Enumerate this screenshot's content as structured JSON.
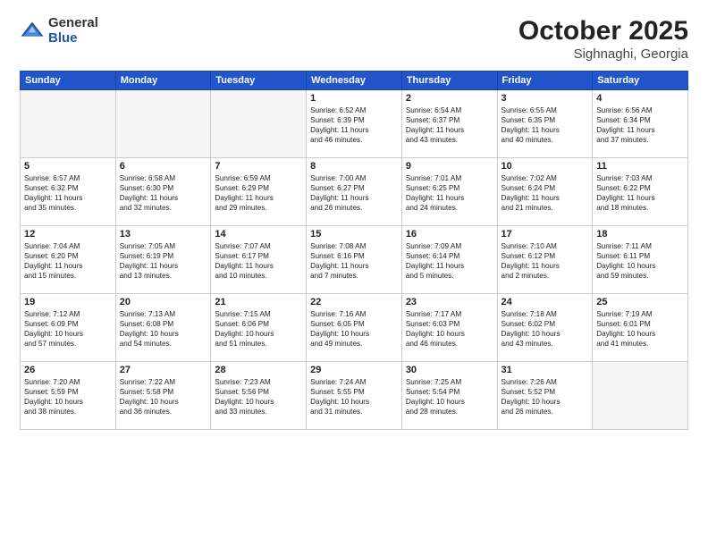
{
  "header": {
    "logo_general": "General",
    "logo_blue": "Blue",
    "month_title": "October 2025",
    "location": "Sighnaghi, Georgia"
  },
  "weekdays": [
    "Sunday",
    "Monday",
    "Tuesday",
    "Wednesday",
    "Thursday",
    "Friday",
    "Saturday"
  ],
  "weeks": [
    [
      {
        "day": "",
        "info": ""
      },
      {
        "day": "",
        "info": ""
      },
      {
        "day": "",
        "info": ""
      },
      {
        "day": "1",
        "info": "Sunrise: 6:52 AM\nSunset: 6:39 PM\nDaylight: 11 hours\nand 46 minutes."
      },
      {
        "day": "2",
        "info": "Sunrise: 6:54 AM\nSunset: 6:37 PM\nDaylight: 11 hours\nand 43 minutes."
      },
      {
        "day": "3",
        "info": "Sunrise: 6:55 AM\nSunset: 6:35 PM\nDaylight: 11 hours\nand 40 minutes."
      },
      {
        "day": "4",
        "info": "Sunrise: 6:56 AM\nSunset: 6:34 PM\nDaylight: 11 hours\nand 37 minutes."
      }
    ],
    [
      {
        "day": "5",
        "info": "Sunrise: 6:57 AM\nSunset: 6:32 PM\nDaylight: 11 hours\nand 35 minutes."
      },
      {
        "day": "6",
        "info": "Sunrise: 6:58 AM\nSunset: 6:30 PM\nDaylight: 11 hours\nand 32 minutes."
      },
      {
        "day": "7",
        "info": "Sunrise: 6:59 AM\nSunset: 6:29 PM\nDaylight: 11 hours\nand 29 minutes."
      },
      {
        "day": "8",
        "info": "Sunrise: 7:00 AM\nSunset: 6:27 PM\nDaylight: 11 hours\nand 26 minutes."
      },
      {
        "day": "9",
        "info": "Sunrise: 7:01 AM\nSunset: 6:25 PM\nDaylight: 11 hours\nand 24 minutes."
      },
      {
        "day": "10",
        "info": "Sunrise: 7:02 AM\nSunset: 6:24 PM\nDaylight: 11 hours\nand 21 minutes."
      },
      {
        "day": "11",
        "info": "Sunrise: 7:03 AM\nSunset: 6:22 PM\nDaylight: 11 hours\nand 18 minutes."
      }
    ],
    [
      {
        "day": "12",
        "info": "Sunrise: 7:04 AM\nSunset: 6:20 PM\nDaylight: 11 hours\nand 15 minutes."
      },
      {
        "day": "13",
        "info": "Sunrise: 7:05 AM\nSunset: 6:19 PM\nDaylight: 11 hours\nand 13 minutes."
      },
      {
        "day": "14",
        "info": "Sunrise: 7:07 AM\nSunset: 6:17 PM\nDaylight: 11 hours\nand 10 minutes."
      },
      {
        "day": "15",
        "info": "Sunrise: 7:08 AM\nSunset: 6:16 PM\nDaylight: 11 hours\nand 7 minutes."
      },
      {
        "day": "16",
        "info": "Sunrise: 7:09 AM\nSunset: 6:14 PM\nDaylight: 11 hours\nand 5 minutes."
      },
      {
        "day": "17",
        "info": "Sunrise: 7:10 AM\nSunset: 6:12 PM\nDaylight: 11 hours\nand 2 minutes."
      },
      {
        "day": "18",
        "info": "Sunrise: 7:11 AM\nSunset: 6:11 PM\nDaylight: 10 hours\nand 59 minutes."
      }
    ],
    [
      {
        "day": "19",
        "info": "Sunrise: 7:12 AM\nSunset: 6:09 PM\nDaylight: 10 hours\nand 57 minutes."
      },
      {
        "day": "20",
        "info": "Sunrise: 7:13 AM\nSunset: 6:08 PM\nDaylight: 10 hours\nand 54 minutes."
      },
      {
        "day": "21",
        "info": "Sunrise: 7:15 AM\nSunset: 6:06 PM\nDaylight: 10 hours\nand 51 minutes."
      },
      {
        "day": "22",
        "info": "Sunrise: 7:16 AM\nSunset: 6:05 PM\nDaylight: 10 hours\nand 49 minutes."
      },
      {
        "day": "23",
        "info": "Sunrise: 7:17 AM\nSunset: 6:03 PM\nDaylight: 10 hours\nand 46 minutes."
      },
      {
        "day": "24",
        "info": "Sunrise: 7:18 AM\nSunset: 6:02 PM\nDaylight: 10 hours\nand 43 minutes."
      },
      {
        "day": "25",
        "info": "Sunrise: 7:19 AM\nSunset: 6:01 PM\nDaylight: 10 hours\nand 41 minutes."
      }
    ],
    [
      {
        "day": "26",
        "info": "Sunrise: 7:20 AM\nSunset: 5:59 PM\nDaylight: 10 hours\nand 38 minutes."
      },
      {
        "day": "27",
        "info": "Sunrise: 7:22 AM\nSunset: 5:58 PM\nDaylight: 10 hours\nand 36 minutes."
      },
      {
        "day": "28",
        "info": "Sunrise: 7:23 AM\nSunset: 5:56 PM\nDaylight: 10 hours\nand 33 minutes."
      },
      {
        "day": "29",
        "info": "Sunrise: 7:24 AM\nSunset: 5:55 PM\nDaylight: 10 hours\nand 31 minutes."
      },
      {
        "day": "30",
        "info": "Sunrise: 7:25 AM\nSunset: 5:54 PM\nDaylight: 10 hours\nand 28 minutes."
      },
      {
        "day": "31",
        "info": "Sunrise: 7:26 AM\nSunset: 5:52 PM\nDaylight: 10 hours\nand 26 minutes."
      },
      {
        "day": "",
        "info": ""
      }
    ]
  ]
}
